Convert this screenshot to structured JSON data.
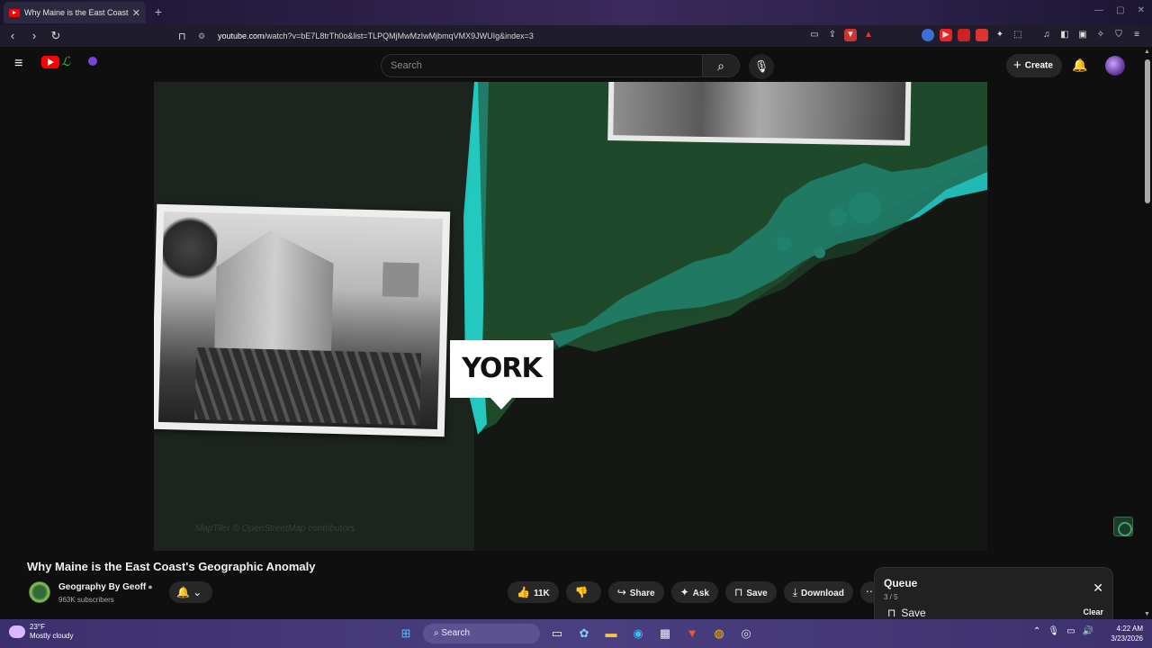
{
  "browser": {
    "tab_title": "Why Maine is the East Coast’s",
    "url_host": "youtube.com",
    "url_path": "/watch?v=bE7L8trTh0o&list=TLPQMjMwMzIwMjbmqVMX9JWUIg&index=3"
  },
  "header": {
    "search_placeholder": "Search",
    "create_label": "Create"
  },
  "video": {
    "overlay_label": "YORK",
    "map_watermark": "MapTiler © OpenStreetMap contributors"
  },
  "info": {
    "title": "Why Maine is the East Coast's Geographic Anomaly",
    "channel": "Geography By Geoff",
    "subscribers": "963K subscribers",
    "likes": "11K",
    "actions": {
      "share": "Share",
      "ask": "Ask",
      "save": "Save",
      "download": "Download"
    }
  },
  "queue": {
    "title": "Queue",
    "count": "3 / 5",
    "save": "Save",
    "clear": "Clear"
  },
  "taskbar": {
    "temp": "23°F",
    "weather": "Mostly cloudy",
    "search": "Search",
    "time": "4:22 AM",
    "date": "3/23/2026"
  },
  "colors": {
    "coast_glow": "#23d6cf",
    "youtube_red": "#ff0000"
  }
}
